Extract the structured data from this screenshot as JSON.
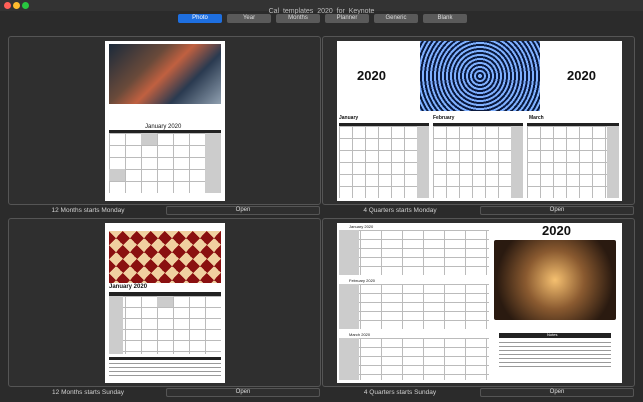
{
  "window": {
    "title": "Cal_templates_2020_for_Keynote"
  },
  "tabs": [
    {
      "label": "Photo",
      "active": true
    },
    {
      "label": "Year",
      "active": false
    },
    {
      "label": "Months",
      "active": false
    },
    {
      "label": "Planner",
      "active": false
    },
    {
      "label": "Generic",
      "active": false
    },
    {
      "label": "Blank",
      "active": false
    }
  ],
  "templates": [
    {
      "caption": "12 Months starts Monday",
      "button": "Open",
      "preview": {
        "month": "January 2020"
      }
    },
    {
      "caption": "4 Quarters starts Monday",
      "button": "Open",
      "preview": {
        "year": "2020",
        "months": [
          "January",
          "February",
          "March"
        ]
      }
    },
    {
      "caption": "12 Months starts Sunday",
      "button": "Open",
      "preview": {
        "month": "January 2020"
      }
    },
    {
      "caption": "4 Quarters starts Sunday",
      "button": "Open",
      "preview": {
        "year": "2020",
        "months": [
          "January 2020",
          "February 2020",
          "March 2020"
        ],
        "notes": "Notes"
      }
    }
  ],
  "colors": {
    "accent": "#1e6fe0"
  }
}
